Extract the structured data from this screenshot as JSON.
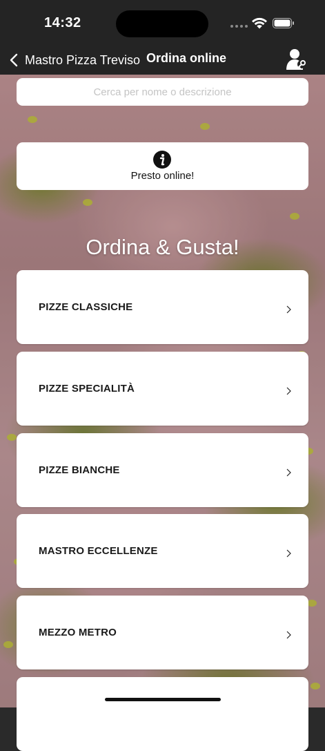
{
  "status_bar": {
    "time": "14:32"
  },
  "nav": {
    "back_label": "Mastro Pizza Treviso",
    "title": "Ordina online"
  },
  "search": {
    "placeholder": "Cerca per nome o descrizione"
  },
  "notice": {
    "text": "Presto online!"
  },
  "heading": "Ordina & Gusta!",
  "categories": [
    {
      "label": "PIZZE CLASSICHE"
    },
    {
      "label": "PIZZE SPECIALITÀ"
    },
    {
      "label": "PIZZE BIANCHE"
    },
    {
      "label": "MASTRO ECCELLENZE"
    },
    {
      "label": "MEZZO METRO"
    },
    {
      "label": ""
    }
  ],
  "colors": {
    "bar_background": "#242424",
    "card_background": "#ffffff",
    "text_dark": "#1a1a1a"
  }
}
